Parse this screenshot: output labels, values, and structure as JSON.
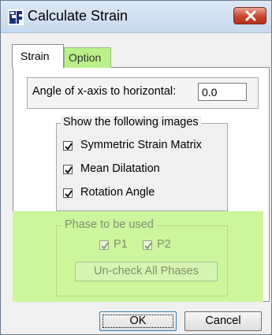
{
  "window": {
    "title": "Calculate Strain",
    "icon": "strain-app-icon",
    "close_icon": "close-icon"
  },
  "tabs": [
    {
      "label": "Strain",
      "selected": true
    },
    {
      "label": "Option",
      "selected": false
    }
  ],
  "angle": {
    "label": "Angle of x-axis to horizontal:",
    "value": "0.0"
  },
  "images_group": {
    "legend": "Show the following images",
    "items": [
      {
        "label": "Symmetric Strain Matrix",
        "checked": true
      },
      {
        "label": "Mean Dilatation",
        "checked": true
      },
      {
        "label": "Rotation Angle",
        "checked": true
      }
    ]
  },
  "phase_group": {
    "legend": "Phase to be used",
    "phases": [
      {
        "label": "P1",
        "checked": true
      },
      {
        "label": "P2",
        "checked": true
      }
    ],
    "uncheck_label": "Un-check All Phases",
    "enabled": false
  },
  "buttons": {
    "ok": "OK",
    "cancel": "Cancel"
  },
  "colors": {
    "highlight": "#cdf59c",
    "option_tab": "#b9f08a",
    "title_bar": "#c9daee",
    "close_button": "#c7462e"
  }
}
